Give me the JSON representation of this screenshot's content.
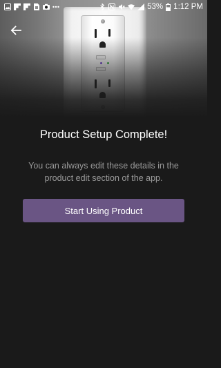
{
  "status_bar": {
    "time": "1:12 PM",
    "battery": "53%",
    "left_icons": [
      "image-icon",
      "flipboard-icon",
      "flipboard-icon",
      "file-icon",
      "camera-icon",
      "dots-icon"
    ],
    "right_icons": [
      "bluetooth-icon",
      "nfc-icon",
      "mute-icon",
      "wifi-icon",
      "signal-icon",
      "battery-icon"
    ]
  },
  "header": {
    "back_icon": "arrow-left-icon",
    "hero_image": "wall-outlet-photo"
  },
  "content": {
    "title": "Product Setup Complete!",
    "message": "You can always edit these details in the product edit section of the app.",
    "primary_button_label": "Start Using Product"
  },
  "colors": {
    "background": "#1a1a1a",
    "button": "#6a5584",
    "message_text": "#9a9a9a",
    "led_purple": "#7b4fd6",
    "led_green": "#3fb24a"
  }
}
